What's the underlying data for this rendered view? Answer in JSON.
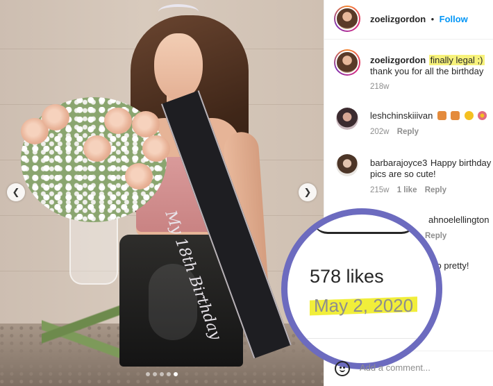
{
  "post": {
    "author": "zoelizgordon",
    "follow_label": "Follow",
    "separator": "•",
    "image_text": "My 18th Birthday",
    "carousel_count": 5,
    "carousel_active": 5
  },
  "caption": {
    "username": "zoelizgordon",
    "highlighted_text": "finally legal ;)",
    "text": "thank you for all the birthday",
    "time": "218w"
  },
  "comments": [
    {
      "username": "leshchinskiiivan",
      "text": "",
      "emoji": [
        "house-emoji",
        "house-emoji",
        "smile-emoji",
        "flower-emoji"
      ],
      "time": "202w",
      "likes": "",
      "reply": "Reply"
    },
    {
      "username": "barbarajoyce3",
      "text": "Happy birthday",
      "text2": "pics are so cute!",
      "time": "215w",
      "likes": "1 like",
      "reply": "Reply"
    },
    {
      "username": "ahnoelellington",
      "text": "",
      "emoji": [
        "sparkle-emoji",
        "sparkle-emoji"
      ],
      "time": "",
      "likes": "",
      "reply": "Reply"
    },
    {
      "username": "",
      "text": "so pretty!",
      "time": "",
      "likes": "",
      "reply": ""
    }
  ],
  "magnifier": {
    "likes": "578 likes",
    "date": "May 2, 2020"
  },
  "add_comment": {
    "placeholder": "Add a comment..."
  },
  "colors": {
    "accent": "#0095f6",
    "highlight": "#f7f27b",
    "magnifier_ring": "#6c6bbf"
  }
}
